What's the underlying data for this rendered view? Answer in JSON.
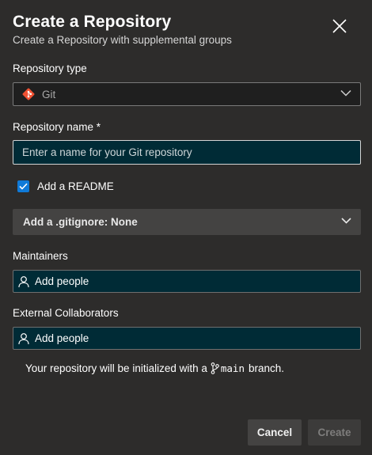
{
  "dialog": {
    "title": "Create a Repository",
    "subtitle": "Create a Repository with supplemental groups"
  },
  "repo_type": {
    "label": "Repository type",
    "value": "Git",
    "icon": "git-icon"
  },
  "repo_name": {
    "label": "Repository name *",
    "placeholder": "Enter a name for your Git repository",
    "value": ""
  },
  "readme": {
    "label": "Add a README",
    "checked": true
  },
  "gitignore": {
    "label": "Add a .gitignore: None"
  },
  "maintainers": {
    "label": "Maintainers",
    "placeholder": "Add people"
  },
  "collaborators": {
    "label": "External Collaborators",
    "placeholder": "Add people"
  },
  "info": {
    "prefix": "Your repository will be initialized with a",
    "branch": "main",
    "suffix": "branch."
  },
  "buttons": {
    "cancel": "Cancel",
    "create": "Create"
  },
  "colors": {
    "background": "#2d2c2b",
    "accent": "#0f7ad8",
    "input_bg": "#002b36",
    "git_brand": "#f05133"
  }
}
